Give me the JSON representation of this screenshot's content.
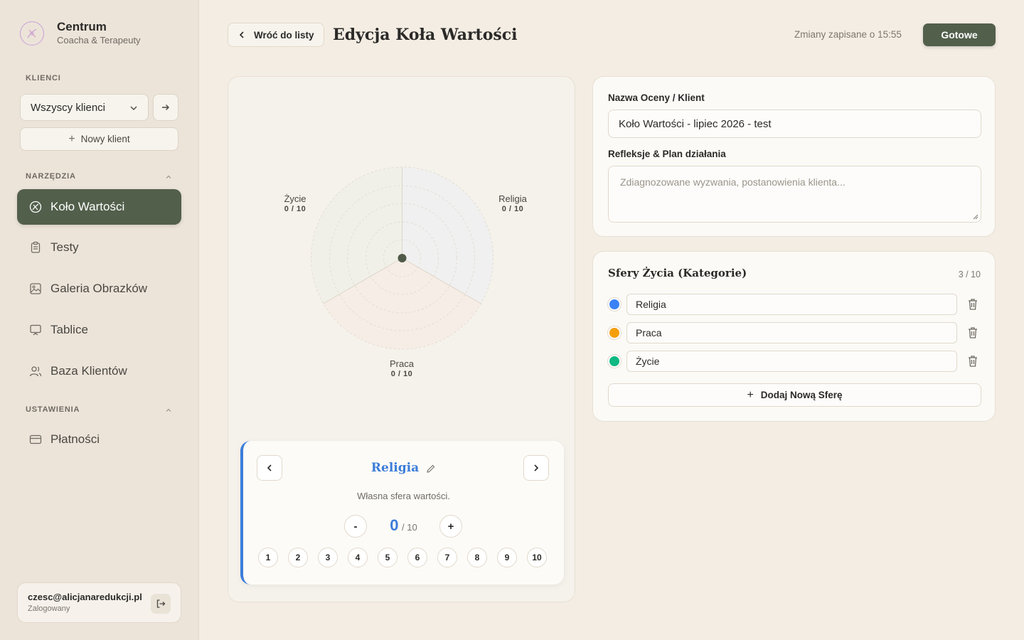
{
  "brand": {
    "name": "Centrum",
    "subtitle": "Coacha & Terapeuty"
  },
  "sidebar": {
    "clients_label": "KLIENCI",
    "client_select_value": "Wszyscy klienci",
    "new_client_label": "Nowy klient",
    "tools_label": "NARZĘDZIA",
    "tools": [
      {
        "label": "Koło Wartości",
        "icon": "wheel-icon",
        "active": true
      },
      {
        "label": "Testy",
        "icon": "clipboard-icon",
        "active": false
      },
      {
        "label": "Galeria Obrazków",
        "icon": "image-icon",
        "active": false
      },
      {
        "label": "Tablice",
        "icon": "board-icon",
        "active": false
      },
      {
        "label": "Baza Klientów",
        "icon": "users-icon",
        "active": false
      }
    ],
    "settings_label": "USTAWIENIA",
    "settings": [
      {
        "label": "Płatności",
        "icon": "card-icon"
      }
    ],
    "user": {
      "email": "czesc@alicjanaredukcji.pl",
      "status": "Zalogowany"
    }
  },
  "header": {
    "back_label": "Wróć do listy",
    "title": "Edycja Koła Wartości",
    "save_status": "Zmiany zapisane o 15:55",
    "done_label": "Gotowe"
  },
  "wheel": {
    "labels": [
      {
        "name": "Życie",
        "score": "0 / 10"
      },
      {
        "name": "Religia",
        "score": "0 / 10"
      },
      {
        "name": "Praca",
        "score": "0 / 10"
      }
    ]
  },
  "sphere_editor": {
    "name": "Religia",
    "description": "Własna sfera wartości.",
    "minus_label": "-",
    "plus_label": "+",
    "score": "0",
    "score_max": "/ 10",
    "numbers": [
      "1",
      "2",
      "3",
      "4",
      "5",
      "6",
      "7",
      "8",
      "9",
      "10"
    ],
    "accent_color": "#3b7dd8"
  },
  "assessment": {
    "name_label": "Nazwa Oceny / Klient",
    "name_value": "Koło Wartości - lipiec 2026 - test",
    "reflections_label": "Refleksje & Plan działania",
    "reflections_placeholder": "Zdiagnozowane wyzwania, postanowienia klienta..."
  },
  "categories": {
    "title": "Sfery Życia (Kategorie)",
    "count": "3 / 10",
    "items": [
      {
        "label": "Religia",
        "color": "#3b82f6"
      },
      {
        "label": "Praca",
        "color": "#f59e0b"
      },
      {
        "label": "Życie",
        "color": "#10b981"
      }
    ],
    "add_label": "Dodaj Nową Sferę"
  }
}
